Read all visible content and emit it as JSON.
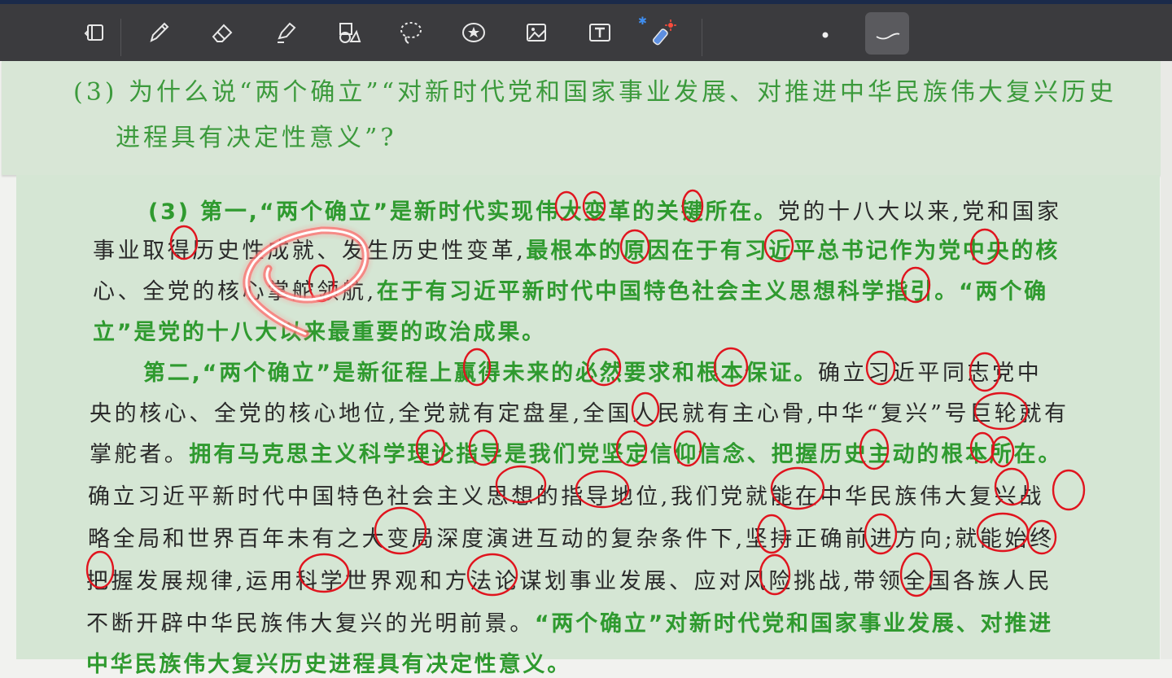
{
  "toolbar": {
    "tools": [
      {
        "name": "page-layout-icon"
      },
      {
        "name": "pen-icon"
      },
      {
        "name": "eraser-icon"
      },
      {
        "name": "highlighter-icon"
      },
      {
        "name": "shapes-icon"
      },
      {
        "name": "lasso-icon"
      },
      {
        "name": "sticker-icon"
      },
      {
        "name": "image-icon"
      },
      {
        "name": "text-box-icon"
      },
      {
        "name": "laser-pointer-icon"
      }
    ],
    "bluetooth_glyph": "✱",
    "accent": "#3f8ef0",
    "ink_color": "#e0141e"
  },
  "question": {
    "line1": "(3) 为什么说“两个确立”“对新时代党和国家事业发展、对推进中华民族伟大复兴历史",
    "line2": "进程具有决定性意义”?"
  },
  "answer": {
    "l1a": "(3) 第一,“两个确立”是新时代实现伟大变革的关键所在。",
    "l1b": "党的十八大以来,党和国家",
    "l2a": "事业取得历史性成就、发生历史性变革,",
    "l2b": "最根本的原因在于有习近平总书记作为党中央的核",
    "l3a": "心、全党的核心掌舵领航,",
    "l3b": "在于有习近平新时代中国特色社会主义思想科学指引。“两个确",
    "l4a": "立”是党的十八大以来最重要的政治成果。",
    "l5a": "第二,“两个确立”是新征程上赢得未来的必然要求和根本保证。",
    "l5b": "确立习近平同志党中",
    "l6a": "央的核心、全党的核心地位,全党就有定盘星,全国人民就有主心骨,中华“复兴”号巨轮就有",
    "l7a": "掌舵者。",
    "l7b": "拥有马克思主义科学理论指导是我们党坚定信仰信念、把握历史主动的根本所在。",
    "l8a": "确立习近平新时代中国特色社会主义思想的指导地位,我们党就能在中华民族伟大复兴战",
    "l9a": "略全局和世界百年未有之大变局深度演进互动的复杂条件下,坚持正确前进方向;就能始终",
    "l10a": "把握发展规律,运用科学世界观和方法论谋划事业发展、应对风险挑战,带领全国各族人民",
    "l11a": "不断开辟中华民族伟大复兴的光明前景。",
    "l11b": "“两个确立”对新时代党和国家事业发展、对推进",
    "l12a": "中华民族伟大复兴历史进程具有决定性意义。"
  }
}
